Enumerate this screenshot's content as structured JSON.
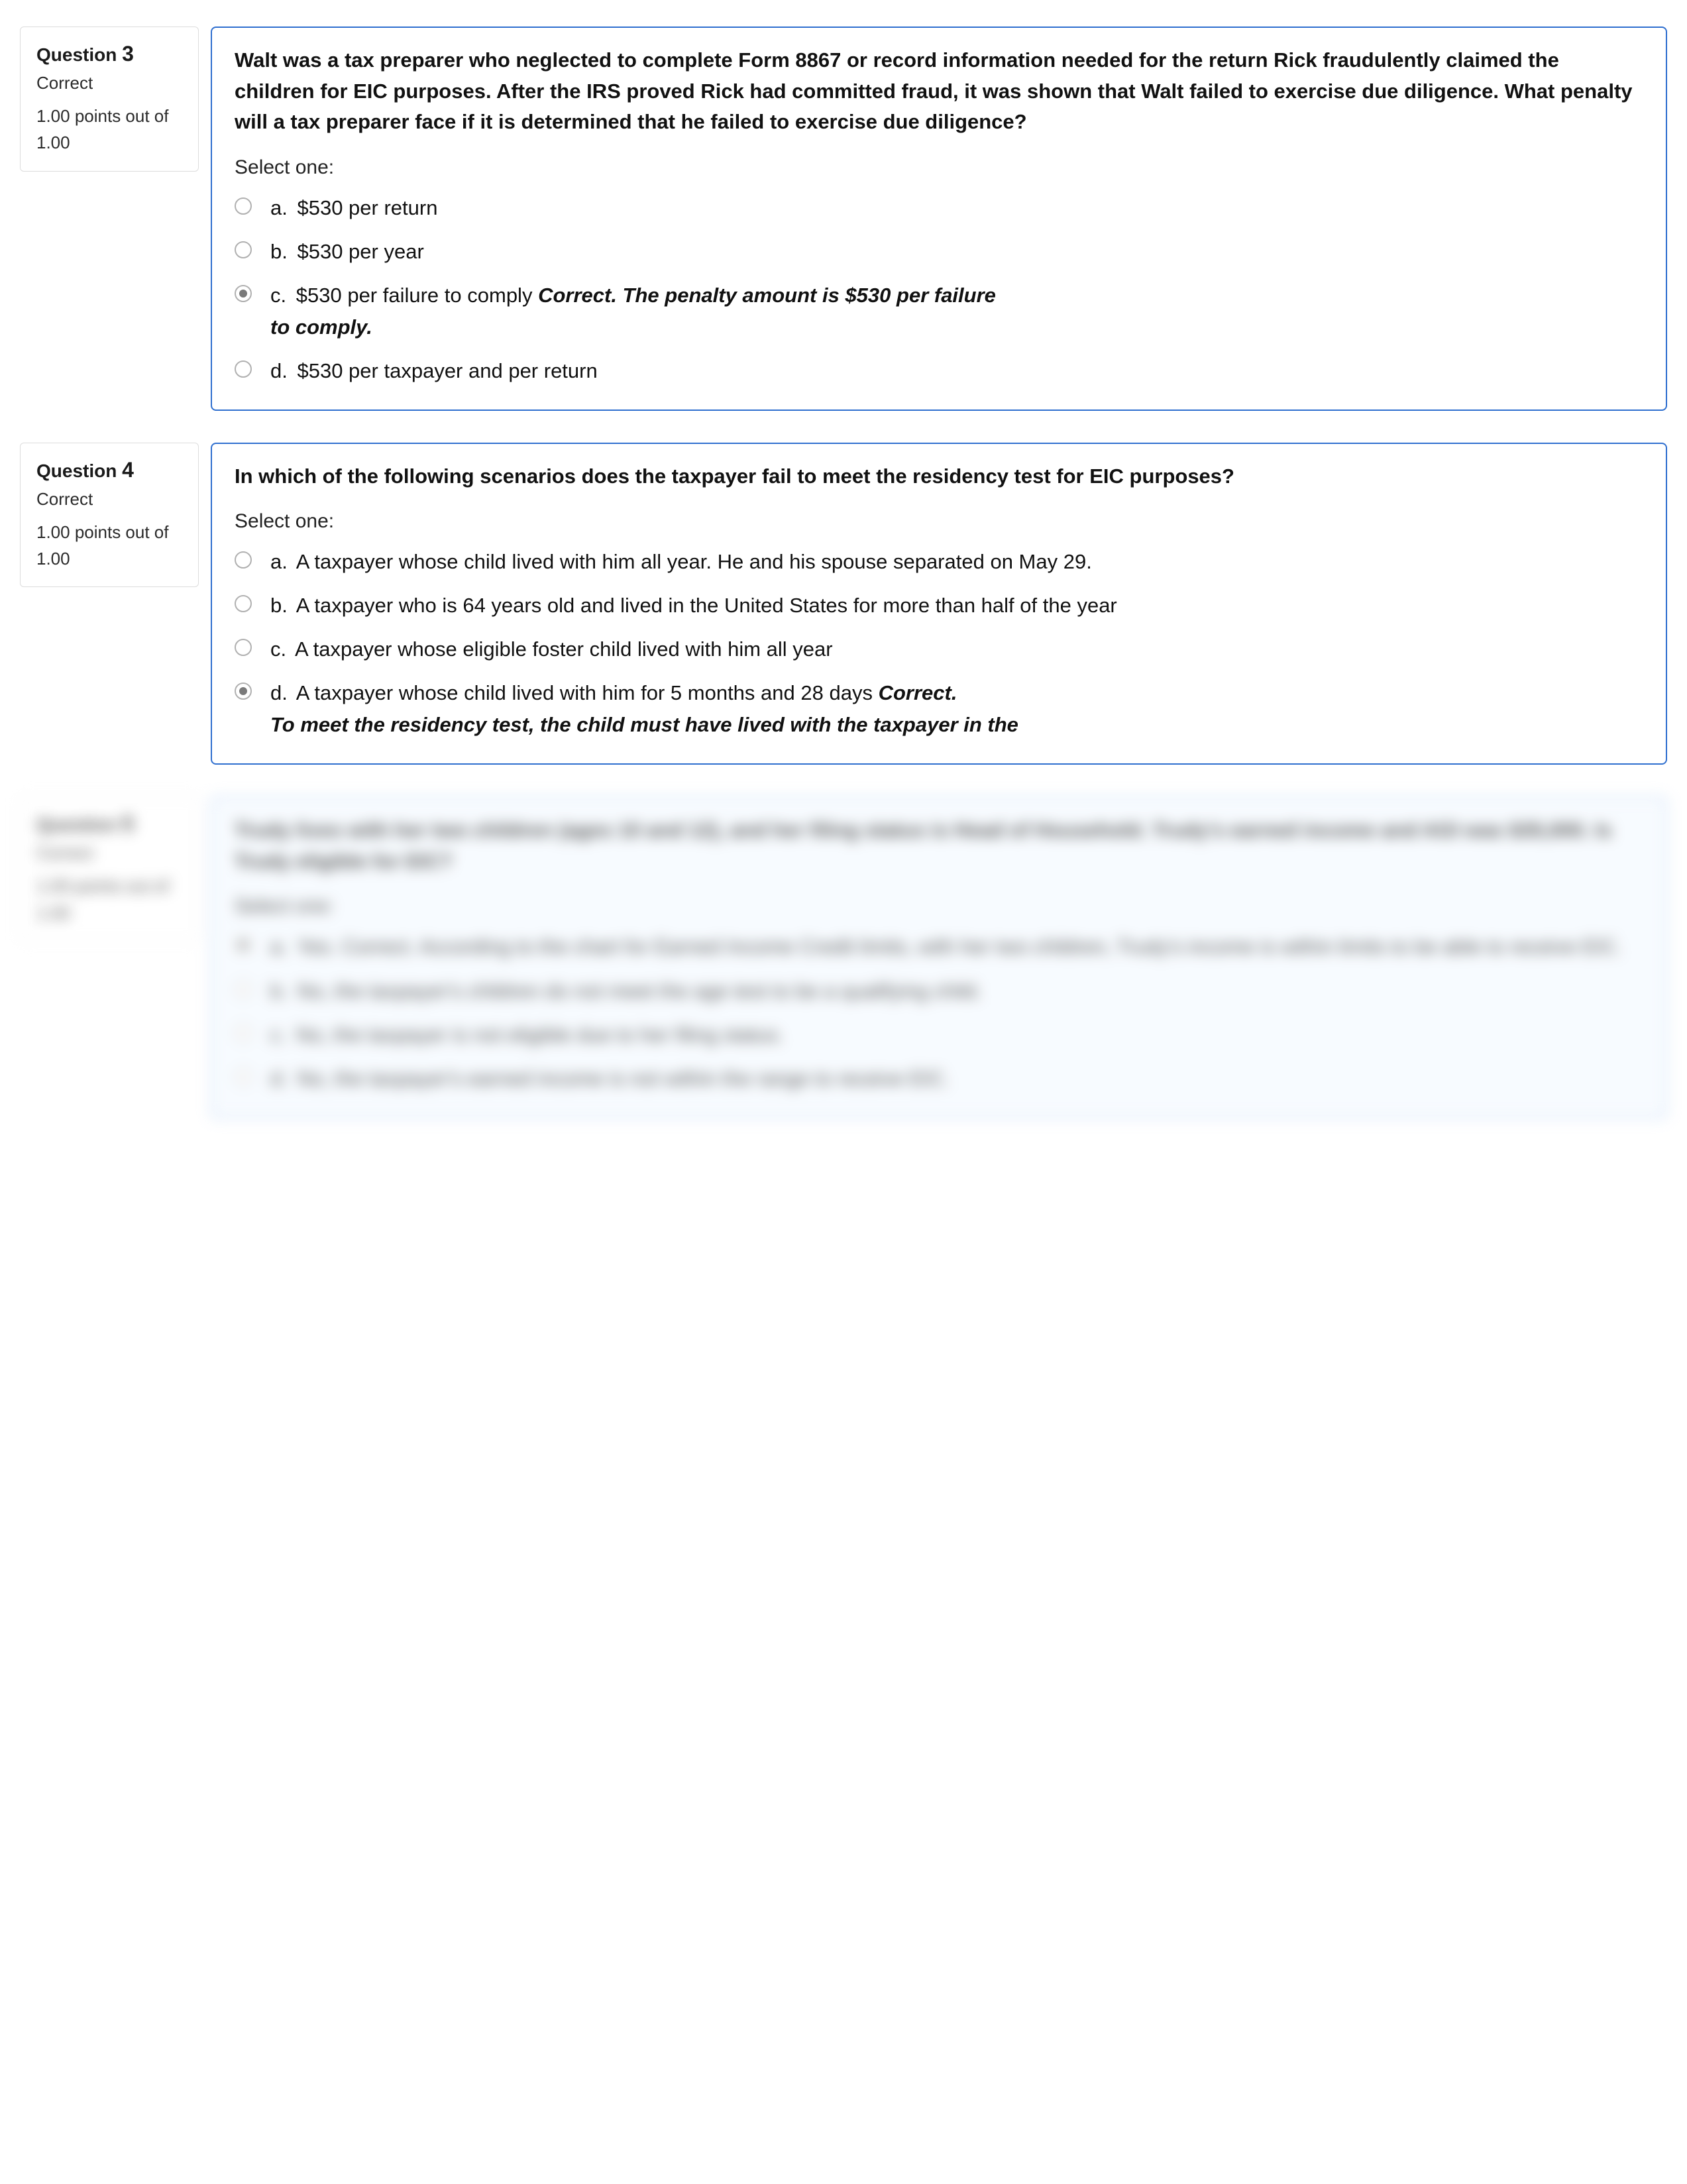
{
  "questions": [
    {
      "number_label": "Question",
      "number": "3",
      "state": "Correct",
      "grade": "1.00 points out of 1.00",
      "stem": "Walt was a tax preparer who neglected to complete Form 8867 or record information needed for the return Rick fraudulently claimed the children for EIC purposes.  After the IRS proved Rick had committed fraud, it was shown that Walt failed to exercise due diligence.  What penalty will a tax preparer face if it is determined that he failed to exercise due diligence?",
      "prompt": "Select one:",
      "answers": [
        {
          "label": "a.",
          "text": "$530 per return",
          "selected": false
        },
        {
          "label": "b.",
          "text": "$530 per year",
          "selected": false
        },
        {
          "label": "c.",
          "text": "$530 per failure to comply",
          "selected": true,
          "feedback_lead": "Correct.  The penalty amount is $530 per failure",
          "feedback_trail": "to comply."
        },
        {
          "label": "d.",
          "text": "$530 per taxpayer and per return",
          "selected": false
        }
      ]
    },
    {
      "number_label": "Question",
      "number": "4",
      "state": "Correct",
      "grade": "1.00 points out of 1.00",
      "stem": "In which of the following scenarios does the taxpayer fail to meet the residency test for EIC purposes?",
      "prompt": "Select one:",
      "answers": [
        {
          "label": "a.",
          "text": "A taxpayer whose child lived with him all year.  He and his spouse separated on May 29.",
          "selected": false
        },
        {
          "label": "b.",
          "text": "A taxpayer who is 64 years old and lived in the United States for more than half of the year",
          "selected": false
        },
        {
          "label": "c.",
          "text": "A taxpayer whose eligible foster child lived with him all year",
          "selected": false
        },
        {
          "label": "d.",
          "text": "A taxpayer whose child lived with him for 5 months and 28 days",
          "selected": true,
          "feedback_lead": "Correct.",
          "feedback_trail": "To meet the residency test, the child must have lived with the taxpayer in the"
        }
      ]
    }
  ],
  "blurred": {
    "number_label": "Question",
    "number": "5",
    "state": "Correct",
    "grade": "1.00 points out of 1.00",
    "stem": "Trudy lives with her two children (ages 10 and 12), and her filing status is Head of Household.  Trudy's earned income and AGI was $35,000.  Is Trudy eligible for EIC?",
    "prompt": "Select one:",
    "answers": [
      {
        "label": "a.",
        "text": "Yes.   Correct.  According to the chart for Earned Income Credit limits, with her two children, Trudy's income is within limits to be able to receive EIC.",
        "selected": true
      },
      {
        "label": "b.",
        "text": "No, the taxpayer's children do not meet the age test to be a qualifying child.",
        "selected": false
      },
      {
        "label": "c.",
        "text": "No, the taxpayer is not eligible due to her filing status.",
        "selected": false
      },
      {
        "label": "d.",
        "text": "No, the taxpayer's earned income is not within the range to receive EIC.",
        "selected": false
      }
    ]
  }
}
